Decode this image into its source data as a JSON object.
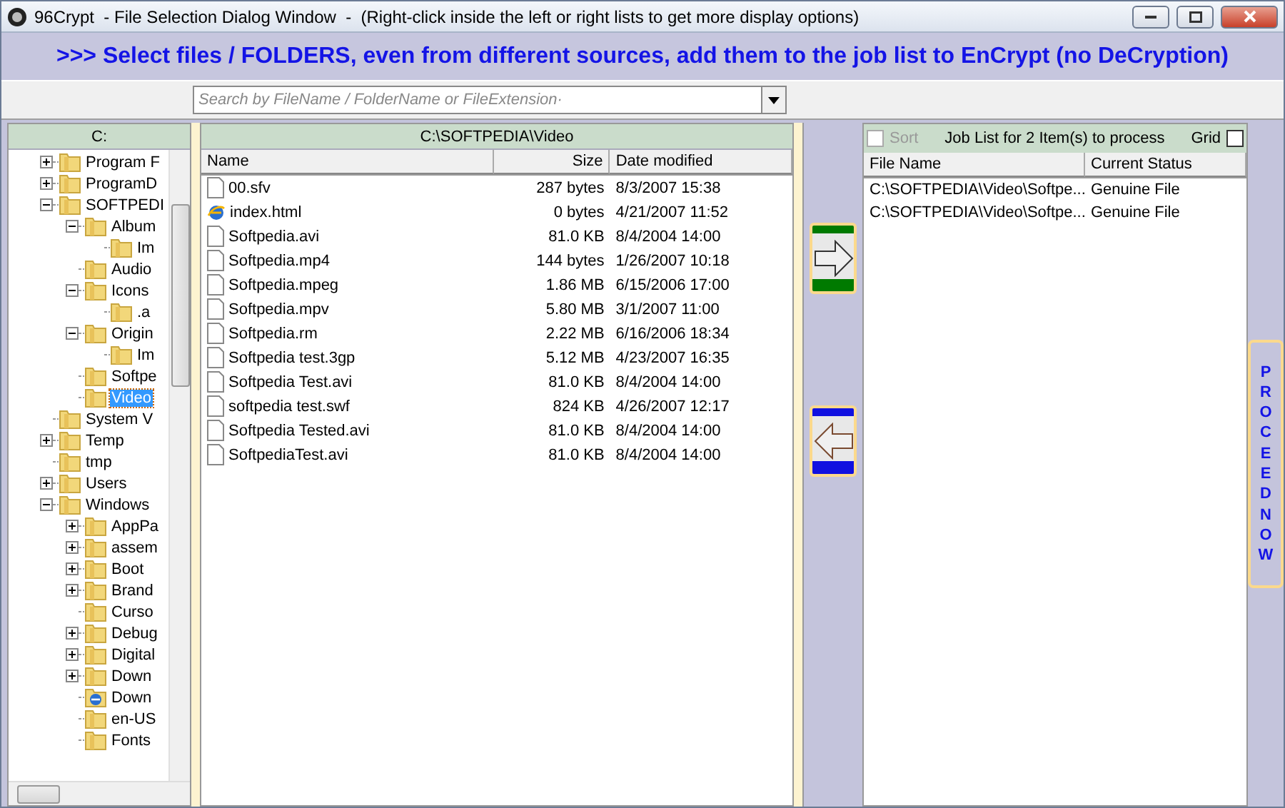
{
  "window": {
    "title": "96Crypt  - File Selection Dialog Window  -  (Right-click inside the left or right lists to get more display options)"
  },
  "banner": ">>> Select files / FOLDERS, even from different sources, add them to the job list to EnCrypt (no DeCryption)",
  "search": {
    "placeholder": "Search by FileName / FolderName or FileExtension·"
  },
  "tree": {
    "header": "C:",
    "items": [
      {
        "label": "Program F",
        "expandable": true,
        "expanded": false,
        "kind": "folder",
        "selected": false
      },
      {
        "label": "ProgramD",
        "expandable": true,
        "expanded": false,
        "kind": "folder",
        "selected": false
      },
      {
        "label": "SOFTPEDI",
        "expandable": true,
        "expanded": true,
        "kind": "folder",
        "selected": false,
        "children": [
          {
            "label": "Album",
            "expandable": true,
            "expanded": true,
            "kind": "folder",
            "selected": false,
            "children": [
              {
                "label": "Im",
                "expandable": false,
                "kind": "folder",
                "selected": false
              }
            ]
          },
          {
            "label": "Audio",
            "expandable": false,
            "kind": "folder",
            "selected": false
          },
          {
            "label": "Icons",
            "expandable": true,
            "expanded": true,
            "kind": "folder",
            "selected": false,
            "children": [
              {
                "label": ".a",
                "expandable": false,
                "kind": "folder",
                "selected": false
              }
            ]
          },
          {
            "label": "Origin",
            "expandable": true,
            "expanded": true,
            "kind": "folder",
            "selected": false,
            "children": [
              {
                "label": "Im",
                "expandable": false,
                "kind": "folder",
                "selected": false
              }
            ]
          },
          {
            "label": "Softpe",
            "expandable": false,
            "kind": "folder",
            "selected": false
          },
          {
            "label": "Video",
            "expandable": false,
            "kind": "folder",
            "selected": true
          }
        ]
      },
      {
        "label": "System V",
        "expandable": false,
        "kind": "folder",
        "selected": false
      },
      {
        "label": "Temp",
        "expandable": true,
        "expanded": false,
        "kind": "folder",
        "selected": false
      },
      {
        "label": "tmp",
        "expandable": false,
        "kind": "folder",
        "selected": false
      },
      {
        "label": "Users",
        "expandable": true,
        "expanded": false,
        "kind": "folder",
        "selected": false
      },
      {
        "label": "Windows",
        "expandable": true,
        "expanded": true,
        "kind": "folder",
        "selected": false,
        "children": [
          {
            "label": "AppPa",
            "expandable": true,
            "expanded": false,
            "kind": "folder",
            "selected": false
          },
          {
            "label": "assem",
            "expandable": true,
            "expanded": false,
            "kind": "folder",
            "selected": false
          },
          {
            "label": "Boot",
            "expandable": true,
            "expanded": false,
            "kind": "folder",
            "selected": false
          },
          {
            "label": "Brand",
            "expandable": true,
            "expanded": false,
            "kind": "folder",
            "selected": false
          },
          {
            "label": "Curso",
            "expandable": false,
            "kind": "folder",
            "selected": false
          },
          {
            "label": "Debug",
            "expandable": true,
            "expanded": false,
            "kind": "folder",
            "selected": false
          },
          {
            "label": "Digital",
            "expandable": true,
            "expanded": false,
            "kind": "folder",
            "selected": false
          },
          {
            "label": "Down",
            "expandable": true,
            "expanded": false,
            "kind": "folder",
            "selected": false
          },
          {
            "label": "Down",
            "expandable": false,
            "kind": "web",
            "selected": false
          },
          {
            "label": "en-US",
            "expandable": false,
            "kind": "folder",
            "selected": false
          },
          {
            "label": "Fonts",
            "expandable": false,
            "kind": "folder",
            "selected": false
          }
        ]
      }
    ]
  },
  "files": {
    "path": "C:\\SOFTPEDIA\\Video",
    "columns": [
      "Name",
      "Size",
      "Date modified"
    ],
    "rows": [
      {
        "name": "00.sfv",
        "size": "287 bytes",
        "date": "8/3/2007 15:38",
        "kind": "file"
      },
      {
        "name": "index.html",
        "size": "0 bytes",
        "date": "4/21/2007 11:52",
        "kind": "web"
      },
      {
        "name": "Softpedia.avi",
        "size": "81.0 KB",
        "date": "8/4/2004 14:00",
        "kind": "file"
      },
      {
        "name": "Softpedia.mp4",
        "size": "144 bytes",
        "date": "1/26/2007 10:18",
        "kind": "file"
      },
      {
        "name": "Softpedia.mpeg",
        "size": "1.86 MB",
        "date": "6/15/2006 17:00",
        "kind": "file"
      },
      {
        "name": "Softpedia.mpv",
        "size": "5.80 MB",
        "date": "3/1/2007 11:00",
        "kind": "file"
      },
      {
        "name": "Softpedia.rm",
        "size": "2.22 MB",
        "date": "6/16/2006 18:34",
        "kind": "file"
      },
      {
        "name": "Softpedia test.3gp",
        "size": "5.12 MB",
        "date": "4/23/2007 16:35",
        "kind": "file"
      },
      {
        "name": "Softpedia Test.avi",
        "size": "81.0 KB",
        "date": "8/4/2004 14:00",
        "kind": "file"
      },
      {
        "name": "softpedia test.swf",
        "size": "824 KB",
        "date": "4/26/2007 12:17",
        "kind": "file"
      },
      {
        "name": "Softpedia Tested.avi",
        "size": "81.0 KB",
        "date": "8/4/2004 14:00",
        "kind": "file"
      },
      {
        "name": "SoftpediaTest.avi",
        "size": "81.0 KB",
        "date": "8/4/2004 14:00",
        "kind": "file"
      }
    ]
  },
  "job": {
    "sort": {
      "label": "Sort",
      "checked": false,
      "disabled": true
    },
    "title": "Job List for 2 Item(s) to process",
    "grid": {
      "label": "Grid",
      "checked": false
    },
    "columns": [
      "File Name",
      "Current Status"
    ],
    "rows": [
      {
        "file": "C:\\SOFTPEDIA\\Video\\Softpe...",
        "status": "Genuine File"
      },
      {
        "file": "C:\\SOFTPEDIA\\Video\\Softpe...",
        "status": "Genuine File"
      }
    ]
  },
  "proceed": "PROCEED NOW"
}
